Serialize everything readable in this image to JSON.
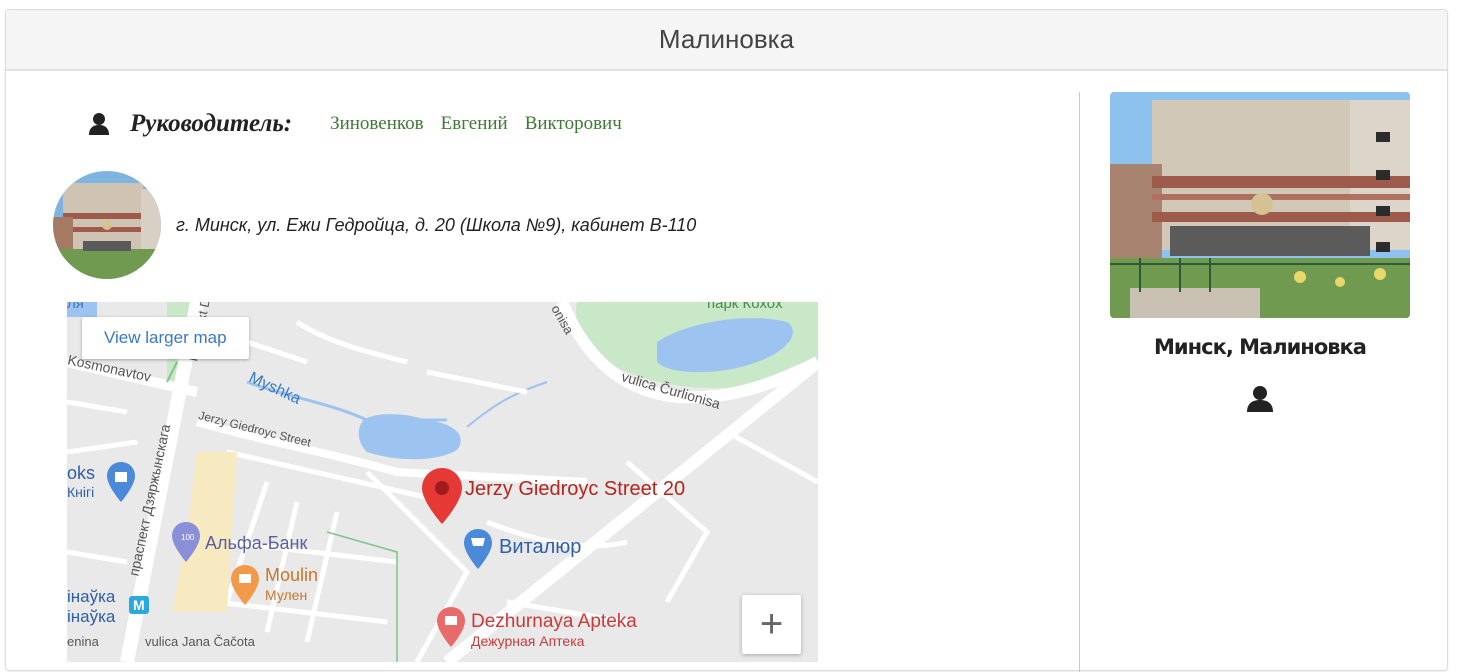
{
  "header": {
    "title": "Малиновка"
  },
  "leader": {
    "label": "Руководитель:",
    "name_parts": [
      "Зиновенков",
      "Евгений",
      "Викторович"
    ]
  },
  "address": "г. Минск, ул. Ежи Гедройца, д. 20 (Школа №9), кабинет В-110",
  "map": {
    "larger_map_link": "View larger map",
    "zoom_in": "+",
    "labels": {
      "park": "парк Кохоx",
      "curlionisa": "vulica Čurlionisa",
      "kosmonavtov": "Kosmonavtov",
      "myshka": "Myshka",
      "giedroyc_street": "Jerzy Giedroyc Street",
      "pin_label": "Jerzy Giedroyc Street 20",
      "books": "oks",
      "knigi": "Кнігі",
      "prospect": "праспект Дзяржынскага",
      "alfa": "Альфа-Банк",
      "vitalur": "Виталюр",
      "moulin": "Moulin",
      "moulin_ru": "Мулен",
      "apteka": "Dezhurnaya Apteka",
      "apteka_ru": "Дежурная Аптека",
      "metro1": "інаўка",
      "metro2": "інаўка",
      "metro_badge": "M",
      "jana": "vulica Jana Čačota",
      "lenina": "enina",
      "top_left": "ля",
      "prospect_top": "Prospekt D",
      "nisa": "onisa",
      "alfa_badge": "100"
    },
    "colors": {
      "road": "#ffffff",
      "water": "#9dc3f0",
      "park": "#c9e8c7",
      "pin": "#e53935"
    }
  },
  "sidebar": {
    "title": "Минск, Малиновка"
  },
  "icons": [
    "user-icon",
    "map-pin-icon",
    "shopping-bag-icon",
    "cart-icon",
    "coffee-icon",
    "pharmacy-icon",
    "bank-icon"
  ]
}
